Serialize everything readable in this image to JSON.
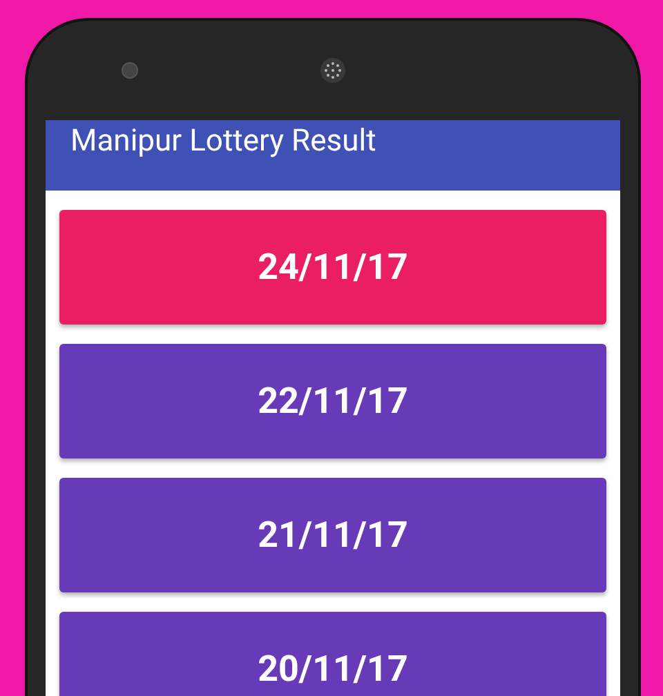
{
  "app_bar": {
    "title": "Manipur Lottery Result"
  },
  "results": [
    {
      "label": "24/11/17",
      "selected": true
    },
    {
      "label": "22/11/17",
      "selected": false
    },
    {
      "label": "21/11/17",
      "selected": false
    },
    {
      "label": "20/11/17",
      "selected": false
    }
  ]
}
